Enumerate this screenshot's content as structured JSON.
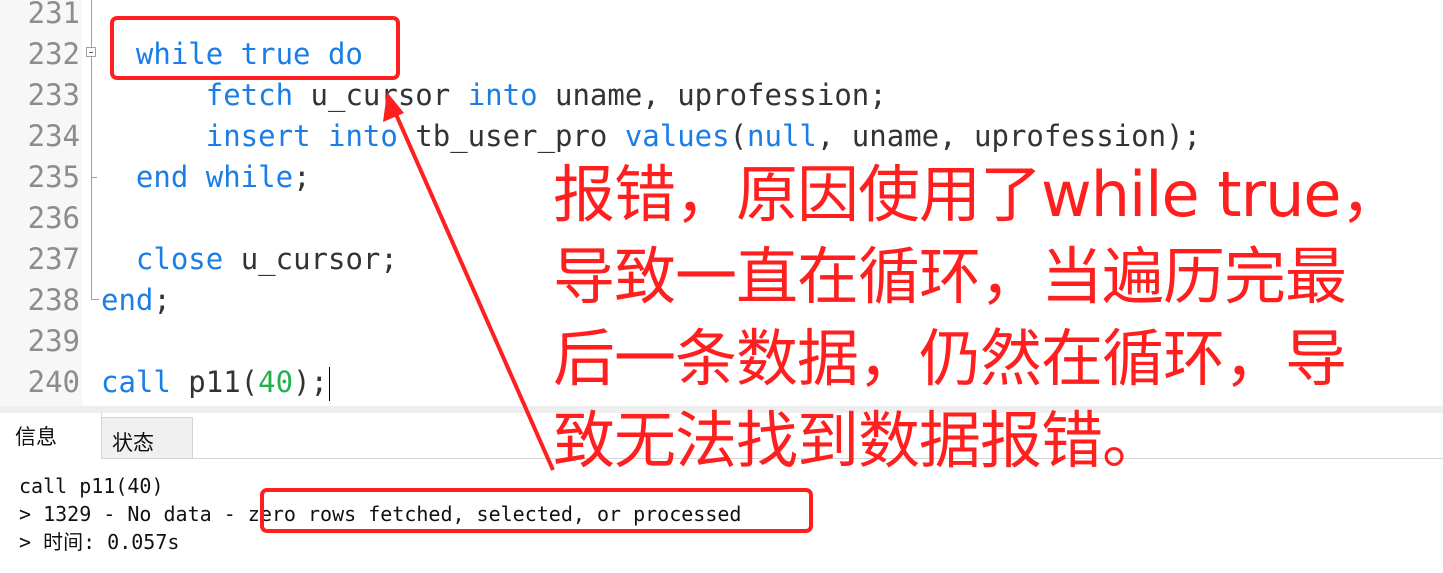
{
  "editor": {
    "lines": [
      {
        "num": "231",
        "tokens": []
      },
      {
        "num": "232",
        "tokens": [
          {
            "t": "  ",
            "c": "plain"
          },
          {
            "t": "while true do",
            "c": "kw"
          }
        ]
      },
      {
        "num": "233",
        "tokens": [
          {
            "t": "      ",
            "c": "plain"
          },
          {
            "t": "fetch",
            "c": "kw"
          },
          {
            "t": " u_cursor ",
            "c": "plain"
          },
          {
            "t": "into",
            "c": "kw"
          },
          {
            "t": " uname, uprofession;",
            "c": "plain"
          }
        ]
      },
      {
        "num": "234",
        "tokens": [
          {
            "t": "      ",
            "c": "plain"
          },
          {
            "t": "insert into",
            "c": "kw"
          },
          {
            "t": " tb_user_pro ",
            "c": "plain"
          },
          {
            "t": "values",
            "c": "kw"
          },
          {
            "t": "(",
            "c": "plain"
          },
          {
            "t": "null",
            "c": "kw"
          },
          {
            "t": ", uname, uprofession);",
            "c": "plain"
          }
        ]
      },
      {
        "num": "235",
        "tokens": [
          {
            "t": "  ",
            "c": "plain"
          },
          {
            "t": "end while",
            "c": "kw"
          },
          {
            "t": ";",
            "c": "plain"
          }
        ]
      },
      {
        "num": "236",
        "tokens": []
      },
      {
        "num": "237",
        "tokens": [
          {
            "t": "  ",
            "c": "plain"
          },
          {
            "t": "close",
            "c": "kw"
          },
          {
            "t": " u_cursor;",
            "c": "plain"
          }
        ]
      },
      {
        "num": "238",
        "tokens": [
          {
            "t": "end",
            "c": "kw"
          },
          {
            "t": ";",
            "c": "plain"
          }
        ]
      },
      {
        "num": "239",
        "tokens": []
      },
      {
        "num": "240",
        "tokens": [
          {
            "t": "call",
            "c": "kw"
          },
          {
            "t": " p11(",
            "c": "plain"
          },
          {
            "t": "40",
            "c": "num"
          },
          {
            "t": ");",
            "c": "plain"
          }
        ],
        "caret": true
      }
    ]
  },
  "panel": {
    "tabs": [
      {
        "label": "信息",
        "active": true
      },
      {
        "label": "状态",
        "active": false
      }
    ],
    "messages": {
      "line1": "call p11(40)",
      "line2_prefix": "> 1329 - No data - ",
      "line2_highlight": "zero rows fetched, selected, or processed",
      "line3": "> 时间: 0.057s"
    }
  },
  "annotation": {
    "color": "#ff1f1f",
    "lines": [
      "报错，原因使用了while true，",
      "导致一直在循环，当遍历完最",
      "后一条数据，仍然在循环，导",
      "致无法找到数据报错。"
    ]
  }
}
